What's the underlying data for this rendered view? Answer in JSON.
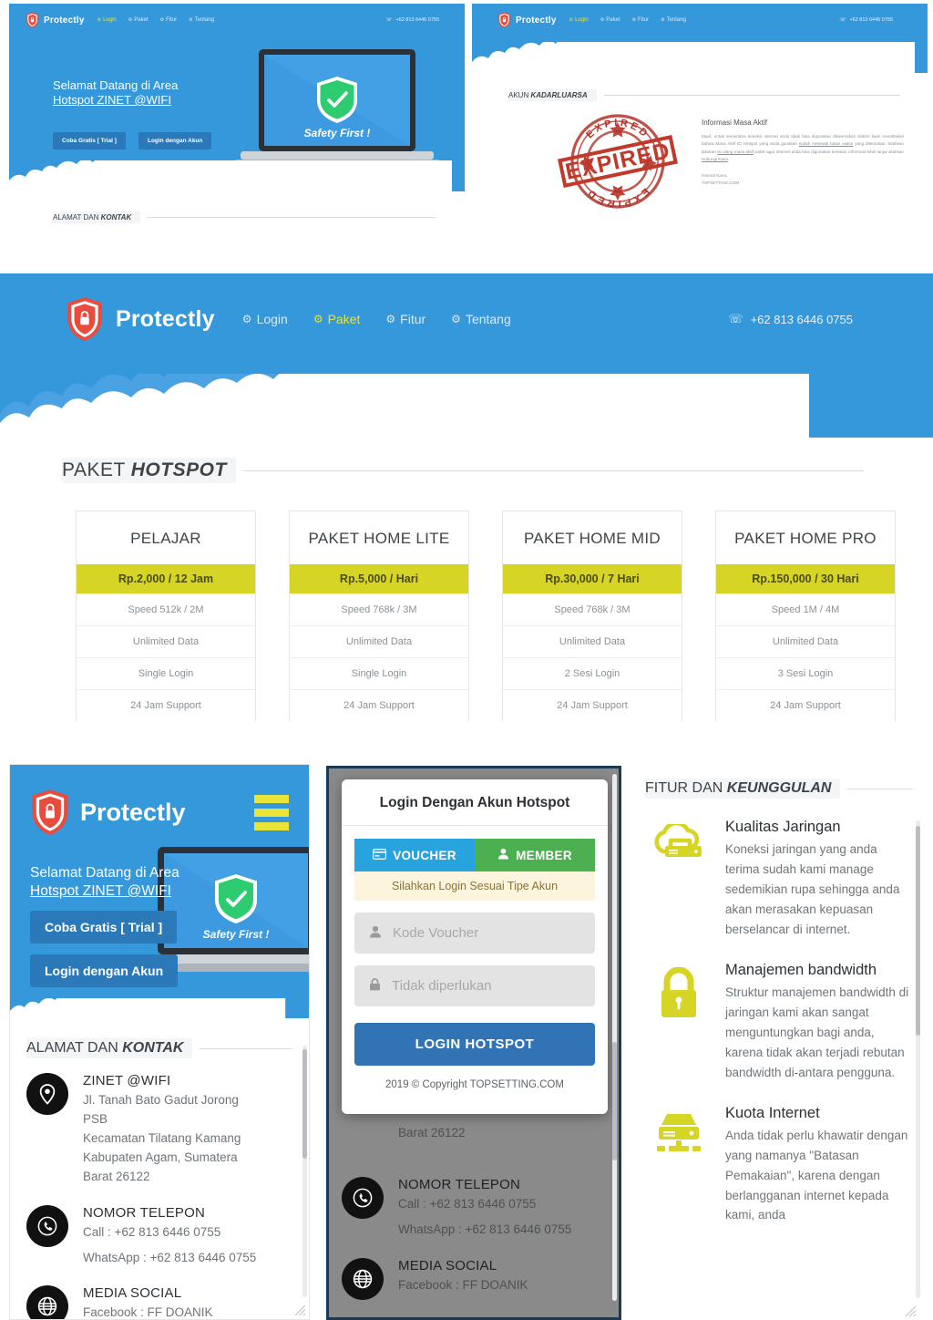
{
  "brand": {
    "name": "Protectly",
    "logo_icon": "shield-lock-icon"
  },
  "nav": {
    "items": [
      {
        "label": "Login",
        "icon": "gear-icon"
      },
      {
        "label": "Paket",
        "icon": "gear-icon"
      },
      {
        "label": "Fitur",
        "icon": "gear-icon"
      },
      {
        "label": "Tentang",
        "icon": "gear-icon"
      }
    ],
    "active_main": "Paket",
    "active_topleft": "Login",
    "active_topright": "Login",
    "phone": "+62 813 6446 0755",
    "phone_icon": "phone-signal-icon"
  },
  "top_left_panel": {
    "hero_line1": "Selamat Datang di Area",
    "hero_line2": "Hotspot ZINET @WIFI",
    "btn_trial": "Coba Gratis [ Trial ]",
    "btn_login": "Login dengan Akun",
    "laptop_caption": "Safety First !",
    "section_title_plain": "ALAMAT DAN ",
    "section_title_em": "KONTAK"
  },
  "top_right_panel": {
    "section_title_plain": "AKUN ",
    "section_title_em": "KADARLUARSA",
    "stamp_text": "EXPIRED",
    "info_heading": "Informasi Masa Aktif",
    "info_body_1": "Maaf, untuk sementara koneksi internet anda tidak bisa digunakan dikarenakan sistem kami mendeteksi bahwa Masa Aktif ID Hotspot yang anda gunakan ",
    "info_link_1": "sudah melewati batas waktu",
    "info_body_2": " yang ditentukan. Silahkan lakukan ",
    "info_link_2": "isi ulang masa aktif",
    "info_body_3": " paket agar internet anda bisa digunakan kembali, informasi lebih lanjut silahkan ",
    "info_link_3": "Hubungi Kami",
    "info_body_4": ".",
    "sign_1": "Hormat Kami,",
    "sign_2": "TOPSETTING.COM"
  },
  "paket": {
    "title_plain": "PAKET ",
    "title_em": "HOTSPOT",
    "cards": [
      {
        "name": "PELAJAR",
        "price": "Rp.2,000 / 12 Jam",
        "features": [
          "Speed 512k / 2M",
          "Unlimited Data",
          "Single Login",
          "24 Jam Support"
        ]
      },
      {
        "name": "PAKET HOME LITE",
        "price": "Rp.5,000 / Hari",
        "features": [
          "Speed 768k / 3M",
          "Unlimited Data",
          "Single Login",
          "24 Jam Support"
        ]
      },
      {
        "name": "PAKET HOME MID",
        "price": "Rp.30,000 / 7 Hari",
        "features": [
          "Speed 768k / 3M",
          "Unlimited Data",
          "2 Sesi Login",
          "24 Jam Support"
        ]
      },
      {
        "name": "PAKET HOME PRO",
        "price": "Rp.150,000 / 30 Hari",
        "features": [
          "Speed 1M / 4M",
          "Unlimited Data",
          "3 Sesi Login",
          "24 Jam Support"
        ]
      }
    ]
  },
  "mobile_left": {
    "hero_line1": "Selamat Datang di Area",
    "hero_line2": "Hotspot ZINET @WIFI",
    "btn_trial": "Coba Gratis [ Trial ]",
    "btn_login": "Login dengan Akun",
    "laptop_caption": "Safety First !",
    "section_title_plain": "ALAMAT DAN ",
    "section_title_em": "KONTAK",
    "contacts": [
      {
        "icon": "map-pin-icon",
        "heading": "ZINET @WIFI",
        "lines": [
          "Jl. Tanah Bato Gadut Jorong",
          "PSB",
          "Kecamatan Tilatang Kamang",
          "Kabupaten Agam, Sumatera",
          "Barat 26122"
        ]
      },
      {
        "icon": "phone-icon",
        "heading": "NOMOR TELEPON",
        "lines": [
          "Call : +62 813 6446 0755",
          "WhatsApp : +62 813 6446 0755"
        ]
      },
      {
        "icon": "globe-icon",
        "heading": "MEDIA SOCIAL",
        "lines": [
          "Facebook : FF DOANIK"
        ]
      }
    ]
  },
  "login_modal": {
    "title": "Login Dengan Akun Hotspot",
    "tab_voucher": "VOUCHER",
    "tab_voucher_icon": "card-icon",
    "tab_member": "MEMBER",
    "tab_member_icon": "user-icon",
    "alert": "Silahkan Login Sesuai Tipe Akun",
    "field_voucher_placeholder": "Kode Voucher",
    "field_voucher_icon": "user-icon",
    "field_voucher_value": "",
    "field_password_placeholder": "Tidak diperlukan",
    "field_password_icon": "lock-icon",
    "field_password_value": "",
    "submit": "LOGIN HOTSPOT",
    "copyright": "2019 © Copyright TOPSETTING.COM",
    "behind_contacts": [
      {
        "icon": "map-pin-icon",
        "heading": "",
        "lines": [
          "Barat 26122"
        ]
      },
      {
        "icon": "phone-icon",
        "heading": "NOMOR TELEPON",
        "lines": [
          "Call : +62 813 6446 0755",
          "WhatsApp : +62 813 6446 0755"
        ]
      },
      {
        "icon": "globe-icon",
        "heading": "MEDIA SOCIAL",
        "lines": [
          "Facebook : FF DOANIK"
        ]
      }
    ]
  },
  "features": {
    "title_plain": "FITUR DAN ",
    "title_em": "KEUNGGULAN",
    "items": [
      {
        "icon": "cloud-server-icon",
        "heading": "Kualitas Jaringan",
        "body": "Koneksi jaringan yang anda terima sudah kami manage sedemikian rupa sehingga anda akan merasakan kepuasan berselancar di internet."
      },
      {
        "icon": "lock-icon",
        "heading": "Manajemen bandwidth",
        "body": "Struktur manajemen bandwidth di jaringan kami akan sangat menguntungkan bagi anda, karena tidak akan terjadi rebutan bandwidth di-antara pengguna."
      },
      {
        "icon": "server-icon",
        "heading": "Kuota Internet",
        "body": "Anda tidak perlu khawatir dengan yang namanya \"Batasan Pemakaian\", karena dengan berlangganan internet kepada kami, anda"
      }
    ]
  },
  "colors": {
    "brand_blue": "#3498db",
    "accent_yellow": "#d6d425",
    "nav_active": "#e8e438",
    "button_blue": "#2b79b8",
    "voucher_tab": "#29a3dd",
    "member_tab": "#4caf50",
    "login_button": "#3273b5",
    "stamp_red": "#c0392b"
  }
}
